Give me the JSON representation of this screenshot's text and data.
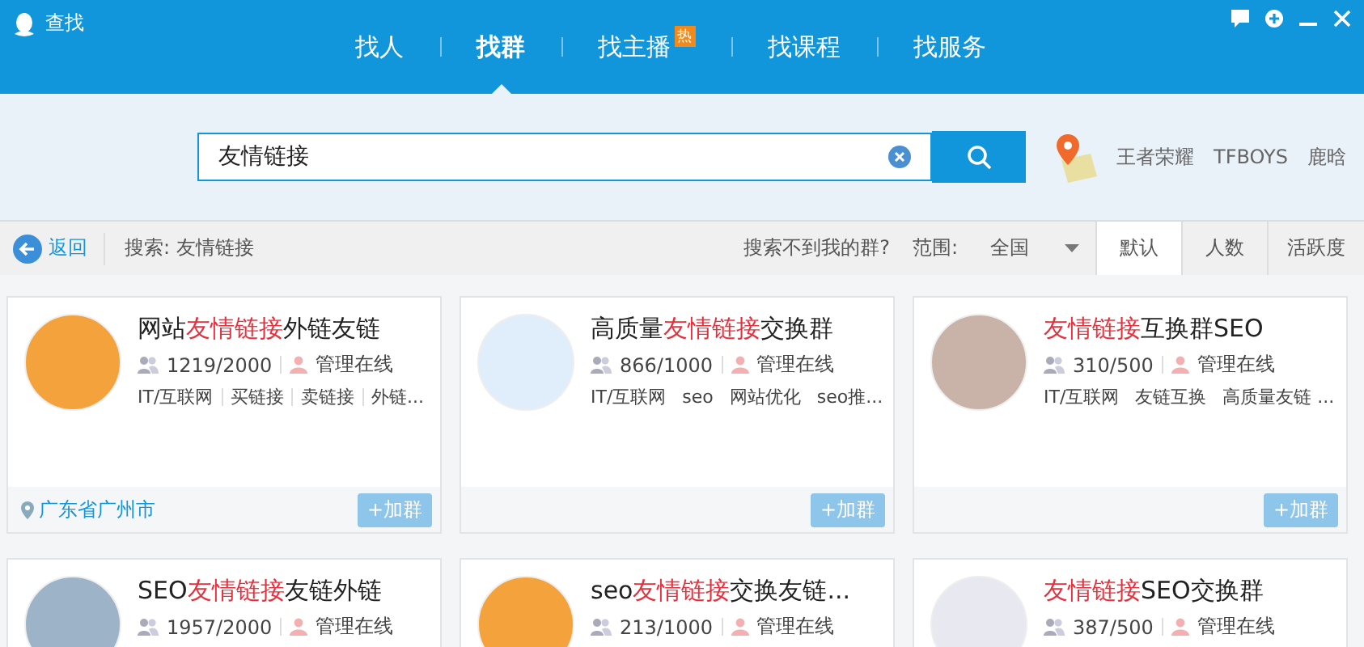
{
  "window": {
    "title": "查找"
  },
  "tabs": [
    {
      "label": "找人",
      "selected": false
    },
    {
      "label": "找群",
      "selected": true
    },
    {
      "label": "找主播",
      "selected": false,
      "badge": "热"
    },
    {
      "label": "找课程",
      "selected": false
    },
    {
      "label": "找服务",
      "selected": false
    }
  ],
  "search": {
    "value": "友情链接",
    "hot_keywords": [
      "王者荣耀",
      "TFBOYS",
      "鹿晗"
    ]
  },
  "filter_bar": {
    "back": "返回",
    "query": "搜索: 友情链接",
    "help": "搜索不到我的群?",
    "range_label": "范围:",
    "range_value": "全国",
    "sort_tabs": [
      {
        "label": "默认",
        "selected": true
      },
      {
        "label": "人数",
        "selected": false
      },
      {
        "label": "活跃度",
        "selected": false
      }
    ]
  },
  "groups": [
    {
      "name": [
        {
          "text": "网站",
          "highlight": false
        },
        {
          "text": "友情链接",
          "highlight": true
        },
        {
          "text": "外链友链",
          "highlight": false
        }
      ],
      "members": "1219/2000",
      "admin": "管理在线",
      "tags": [
        "IT/互联网",
        "买链接",
        "卖链接",
        "外链..."
      ],
      "location": "广东省广州市",
      "join": "+加群"
    },
    {
      "name": [
        {
          "text": "高质量",
          "highlight": false
        },
        {
          "text": "友情链接",
          "highlight": true
        },
        {
          "text": "交换群",
          "highlight": false
        }
      ],
      "members": "866/1000",
      "admin": "管理在线",
      "tags": [
        "IT/互联网",
        "seo",
        "网站优化",
        "seo推..."
      ],
      "join": "+加群"
    },
    {
      "name": [
        {
          "text": "友情链接",
          "highlight": true
        },
        {
          "text": "互换群SEO",
          "highlight": false
        }
      ],
      "members": "310/500",
      "admin": "管理在线",
      "tags": [
        "IT/互联网",
        "友链互换",
        "高质量友链 ..."
      ],
      "join": "+加群"
    },
    {
      "name": [
        {
          "text": "SEO",
          "highlight": false
        },
        {
          "text": "友情链接",
          "highlight": true
        },
        {
          "text": "友链外链",
          "highlight": false
        }
      ],
      "members": "1957/2000",
      "admin": "管理在线"
    },
    {
      "name": [
        {
          "text": "seo",
          "highlight": false
        },
        {
          "text": "友情链接",
          "highlight": true
        },
        {
          "text": "交换友链...",
          "highlight": false
        }
      ],
      "members": "213/1000",
      "admin": "管理在线"
    },
    {
      "name": [
        {
          "text": "友情链接",
          "highlight": true
        },
        {
          "text": "SEO交换群",
          "highlight": false
        }
      ],
      "members": "387/500",
      "admin": "管理在线"
    }
  ]
}
